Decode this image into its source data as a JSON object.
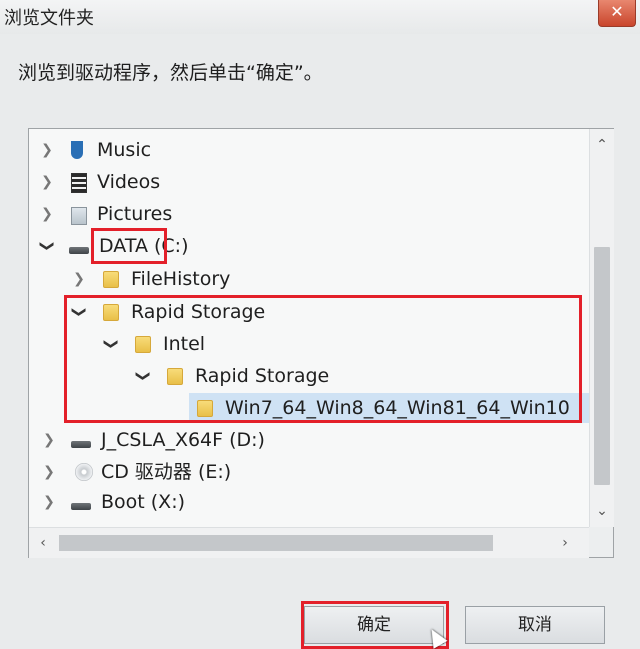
{
  "window": {
    "title": "浏览文件夹",
    "close_glyph": "✕"
  },
  "instruction": "浏览到驱动程序，然后单击“确定”。",
  "tree": {
    "items": [
      {
        "label": "Music",
        "icon": "music-icon",
        "expanded": false
      },
      {
        "label": "Videos",
        "icon": "video-icon",
        "expanded": false
      },
      {
        "label": "Pictures",
        "icon": "picture-icon",
        "expanded": false
      },
      {
        "label": "DATA (C:)",
        "icon": "drive-icon",
        "expanded": true
      },
      {
        "label": "FileHistory",
        "icon": "folder-icon",
        "expanded": false
      },
      {
        "label": "Rapid Storage",
        "icon": "folder-icon",
        "expanded": true
      },
      {
        "label": "Intel",
        "icon": "folder-icon",
        "expanded": true
      },
      {
        "label": "Rapid Storage",
        "icon": "folder-icon",
        "expanded": true
      },
      {
        "label": "Win7_64_Win8_64_Win81_64_Win10",
        "icon": "folder-icon",
        "selected": true
      },
      {
        "label": "J_CSLA_X64F (D:)",
        "icon": "drive-icon",
        "expanded": false
      },
      {
        "label": "CD 驱动器 (E:)",
        "icon": "cd-drive-icon",
        "expanded": false
      },
      {
        "label": "Boot (X:)",
        "icon": "drive-icon",
        "expanded": false
      }
    ]
  },
  "buttons": {
    "ok_label": "确定",
    "cancel_label": "取消"
  },
  "colors": {
    "highlight_box": "#e3202a",
    "selection": "#cfe2f4"
  }
}
